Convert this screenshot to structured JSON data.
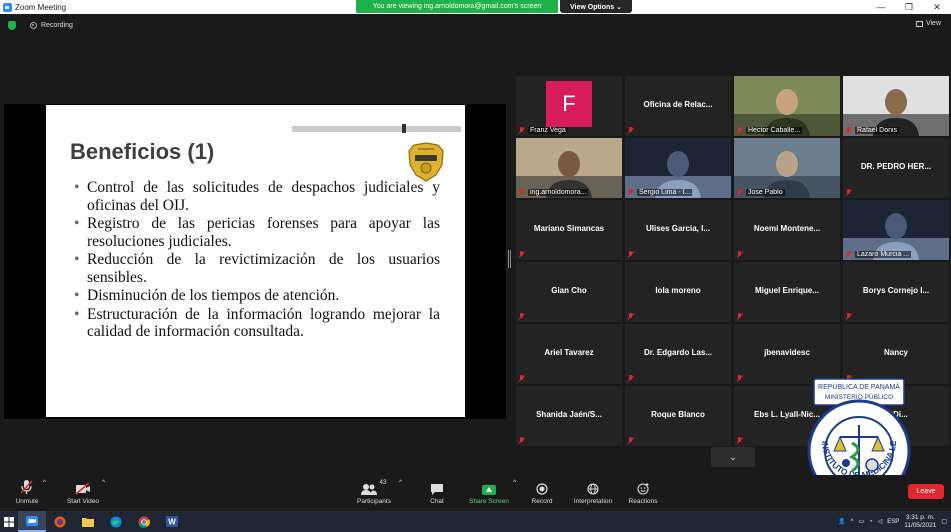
{
  "window": {
    "title": "Zoom Meeting",
    "viewing_banner": "You are viewing ing.arnoldomora@gmail.com's screen",
    "view_options": "View Options ⌄"
  },
  "status": {
    "recording": "Recording",
    "view_label": "View"
  },
  "slide": {
    "title": "Beneficios (1)",
    "bullets": [
      "Control de las solicitudes de despachos judiciales y oficinas del OIJ.",
      "Registro de las pericias forenses para apoyar las resoluciones judiciales.",
      "Reducción de la revictimización de los usuarios sensibles.",
      "Disminución de los tiempos de atención.",
      "Estructuración de la información logrando mejorar la calidad de información consultada."
    ]
  },
  "gallery": {
    "tiles": [
      {
        "name": "Franz Vega",
        "style": "avatar",
        "avatar_letter": "F"
      },
      {
        "name": "Oficina de Relac...",
        "style": "name"
      },
      {
        "name": "Hector Caballe...",
        "style": "video"
      },
      {
        "name": "Rafael Donis",
        "style": "video"
      },
      {
        "name": "ing.arnoldomora...",
        "style": "video",
        "active": true
      },
      {
        "name": "Sergio Lima - I...",
        "style": "video"
      },
      {
        "name": "Jose Pablo",
        "style": "video"
      },
      {
        "name": "DR. PEDRO HER...",
        "style": "name"
      },
      {
        "name": "Mariano Simancas",
        "style": "name"
      },
      {
        "name": "Ulises Garcia, I...",
        "style": "name"
      },
      {
        "name": "Noemi Montene...",
        "style": "name"
      },
      {
        "name": "Lazaro Murcia ...",
        "style": "video"
      },
      {
        "name": "Gian Cho",
        "style": "name"
      },
      {
        "name": "Iola moreno",
        "style": "name"
      },
      {
        "name": "Miguel Enrique...",
        "style": "name"
      },
      {
        "name": "Borys Cornejo I...",
        "style": "name"
      },
      {
        "name": "Ariel Tavarez",
        "style": "name"
      },
      {
        "name": "Dr. Edgardo Las...",
        "style": "name"
      },
      {
        "name": "jbenavidesc",
        "style": "name"
      },
      {
        "name": "Nancy",
        "style": "name"
      },
      {
        "name": "Shanida Jaén/S...",
        "style": "name"
      },
      {
        "name": "Roque Blanco",
        "style": "name"
      },
      {
        "name": "Ebs L. Lyall-Nic...",
        "style": "name"
      },
      {
        "name": "... Di...",
        "style": "name"
      }
    ]
  },
  "seal": {
    "line1": "REPÚBLICA DE PANAMÁ",
    "line2": "MINISTERIO PÚBLICO",
    "arc": "INSTITUTO DE MEDICINA LEGAL Y CIENCIAS FORENSES"
  },
  "toolbar": {
    "unmute": "Unmute",
    "start_video": "Start Video",
    "participants": "Participants",
    "participants_count": "43",
    "chat": "Chat",
    "share_screen": "Share Screen",
    "record": "Record",
    "interpretation": "Interpretation",
    "reactions": "Reactions",
    "leave": "Leave"
  },
  "taskbar": {
    "language": "ESP",
    "time": "3:31 p. m.",
    "date": "11/05/2021"
  },
  "colors": {
    "banner_green": "#21b14b",
    "leave_red": "#e0282d",
    "avatar_pink": "#d81b5b",
    "active_speaker": "#c8e83c"
  }
}
